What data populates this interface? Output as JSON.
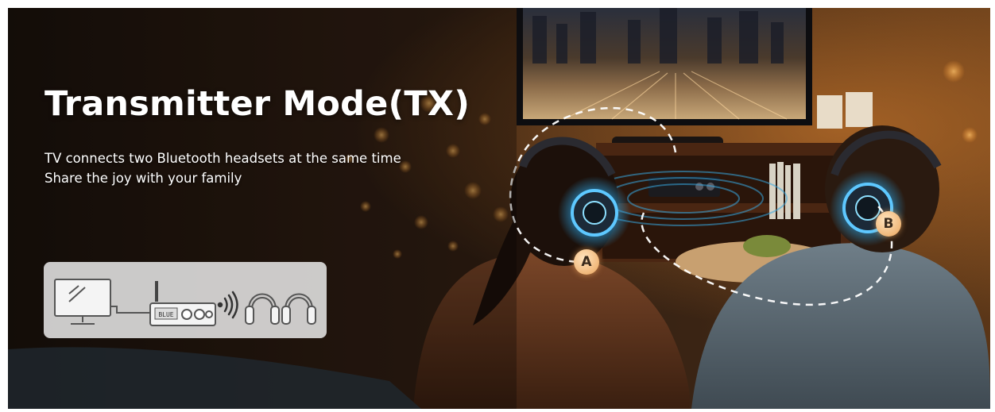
{
  "headline": "Transmitter Mode(TX)",
  "subtext": {
    "line1": "TV connects two Bluetooth headsets at the same time",
    "line2": "Share the joy with your family"
  },
  "badges": {
    "a": "A",
    "b": "B"
  },
  "device_display": "BLUE",
  "colors": {
    "headline": "#ffffff",
    "badge": "#f1b87a",
    "signal_rings": "#38a8e0",
    "dashed_path": "#ffffff"
  },
  "icons": [
    "tv-icon",
    "transmitter-device-icon",
    "wireless-signal-icon",
    "headphones-icon",
    "headphones-icon"
  ]
}
